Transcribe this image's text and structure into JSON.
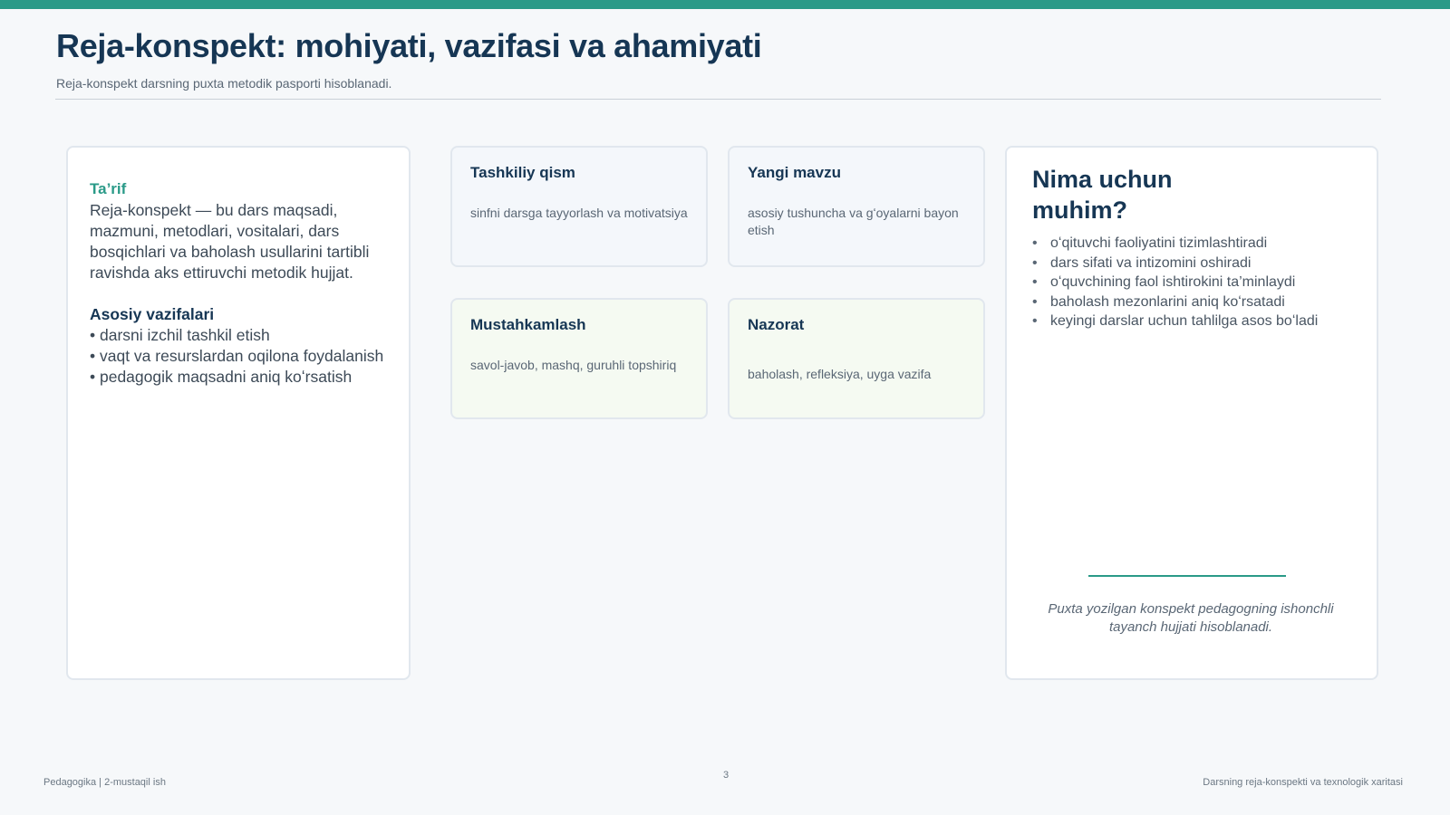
{
  "slide": {
    "title": "Reja-konspekt: mohiyati, vazifasi va ahamiyati",
    "subtitle": "Reja-konspekt darsning puxta metodik pasporti hisoblanadi."
  },
  "definition_card": {
    "tarif_title": "Ta’rif",
    "tarif_text": "Reja-konspekt — bu dars maqsadi, mazmuni, metodlari, vositalari, dars bosqichlari va baholash usullarini tartibli ravishda aks ettiruvchi metodik hujjat.",
    "vazifalar_title": "Asosiy vazifalari",
    "vazifalar": [
      "• darsni izchil tashkil etish",
      "• vaqt va resurslardan oqilona foydalanish",
      "• pedagogik maqsadni aniq koʻrsatish"
    ]
  },
  "steps": [
    {
      "title": "Tashkiliy qism",
      "text": "sinfni darsga tayyorlash va motivatsiya"
    },
    {
      "title": "Yangi mavzu",
      "text": "asosiy tushuncha va gʻoyalarni bayon etish"
    },
    {
      "title": "Mustahkamlash",
      "text": "savol-javob, mashq, guruhli topshiriq"
    },
    {
      "title": "Nazorat",
      "text": "baholash, refleksiya, uyga vazifa"
    }
  ],
  "importance_card": {
    "title": "Nima uchun muhim?",
    "items": [
      "oʻqituvchi faoliyatini tizimlashtiradi",
      "dars sifati va intizomini oshiradi",
      "oʻquvchining faol ishtirokini ta’minlaydi",
      "baholash mezonlarini aniq koʻrsatadi",
      "keyingi darslar uchun tahlilga asos boʻladi"
    ],
    "quote": "Puxta yozilgan konspekt pedagogning ishonchli tayanch hujjati hisoblanadi."
  },
  "footer": {
    "left": "Pedagogika | 2-mustaqil ish",
    "page_number": "3",
    "right": "Darsning reja-konspekti va texnologik xaritasi"
  },
  "colors": {
    "accent": "#2a9a88",
    "heading": "#163654",
    "background": "#f6f8fa"
  }
}
